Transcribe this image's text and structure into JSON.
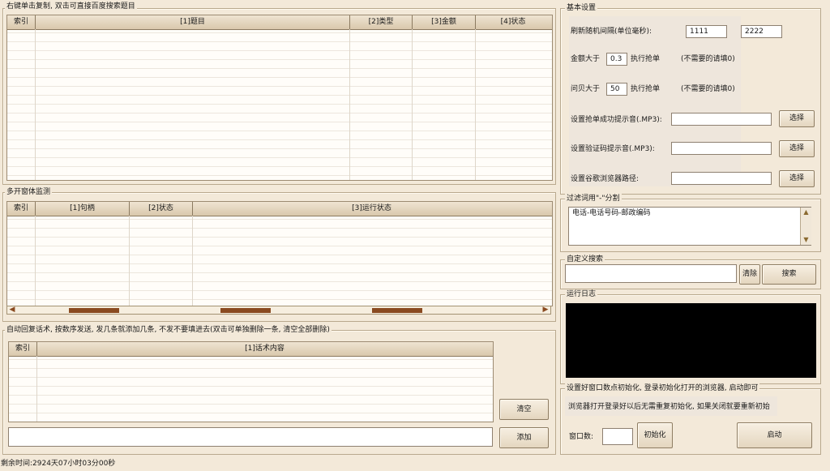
{
  "top_table": {
    "title": "右键单击复制, 双击可直接百度搜索题目",
    "columns": [
      "索引",
      "[1]题目",
      "[2]类型",
      "[3]金额",
      "[4]状态"
    ]
  },
  "monitor_table": {
    "title": "多开窗体监测",
    "columns": [
      "索引",
      "[1]句柄",
      "[2]状态",
      "[3]运行状态"
    ]
  },
  "reply_table": {
    "title": "自动回复话术, 按数序发送, 发几条就添加几条, 不发不要填进去(双击可单独删除一条, 清空全部删除)",
    "columns": [
      "索引",
      "[1]话术内容"
    ],
    "clear_label": "清空",
    "add_label": "添加",
    "input_value": ""
  },
  "basic_settings": {
    "title": "基本设置",
    "refresh_label": "刷新随机间隔(单位毫秒):",
    "refresh_min": "1111",
    "refresh_max": "2222",
    "amount_prefix": "金额大于",
    "amount_value": "0.3",
    "amount_suffix": "执行抢单",
    "amount_note": "(不需要的请填0)",
    "shell_prefix": "问贝大于",
    "shell_value": "50",
    "shell_suffix": "执行抢单",
    "shell_note": "(不需要的请填0)",
    "success_sound_label": "设置抢单成功提示音(.MP3):",
    "captcha_sound_label": "设置验证码提示音(.MP3):",
    "chrome_path_label": "设置谷歌浏览器路径:",
    "choose_label": "选择"
  },
  "filter": {
    "title": "过滤词用\"-\"分割",
    "value": "电话-电话号码-邮政编码"
  },
  "custom_search": {
    "title": "自定义搜索",
    "clear_label": "清除",
    "search_label": "搜索",
    "value": ""
  },
  "run_log": {
    "title": "运行日志"
  },
  "init": {
    "title": "设置好窗口数点初始化, 登录初始化打开的浏览器, 启动即可",
    "note": "浏览器打开登录好以后无需重复初始化, 如果关闭就要重新初始",
    "window_count_label": "窗口数:",
    "window_count_value": "",
    "init_label": "初始化",
    "start_label": "启动"
  },
  "status_bar": {
    "text": "剩余时间:2924天07小时03分00秒"
  }
}
